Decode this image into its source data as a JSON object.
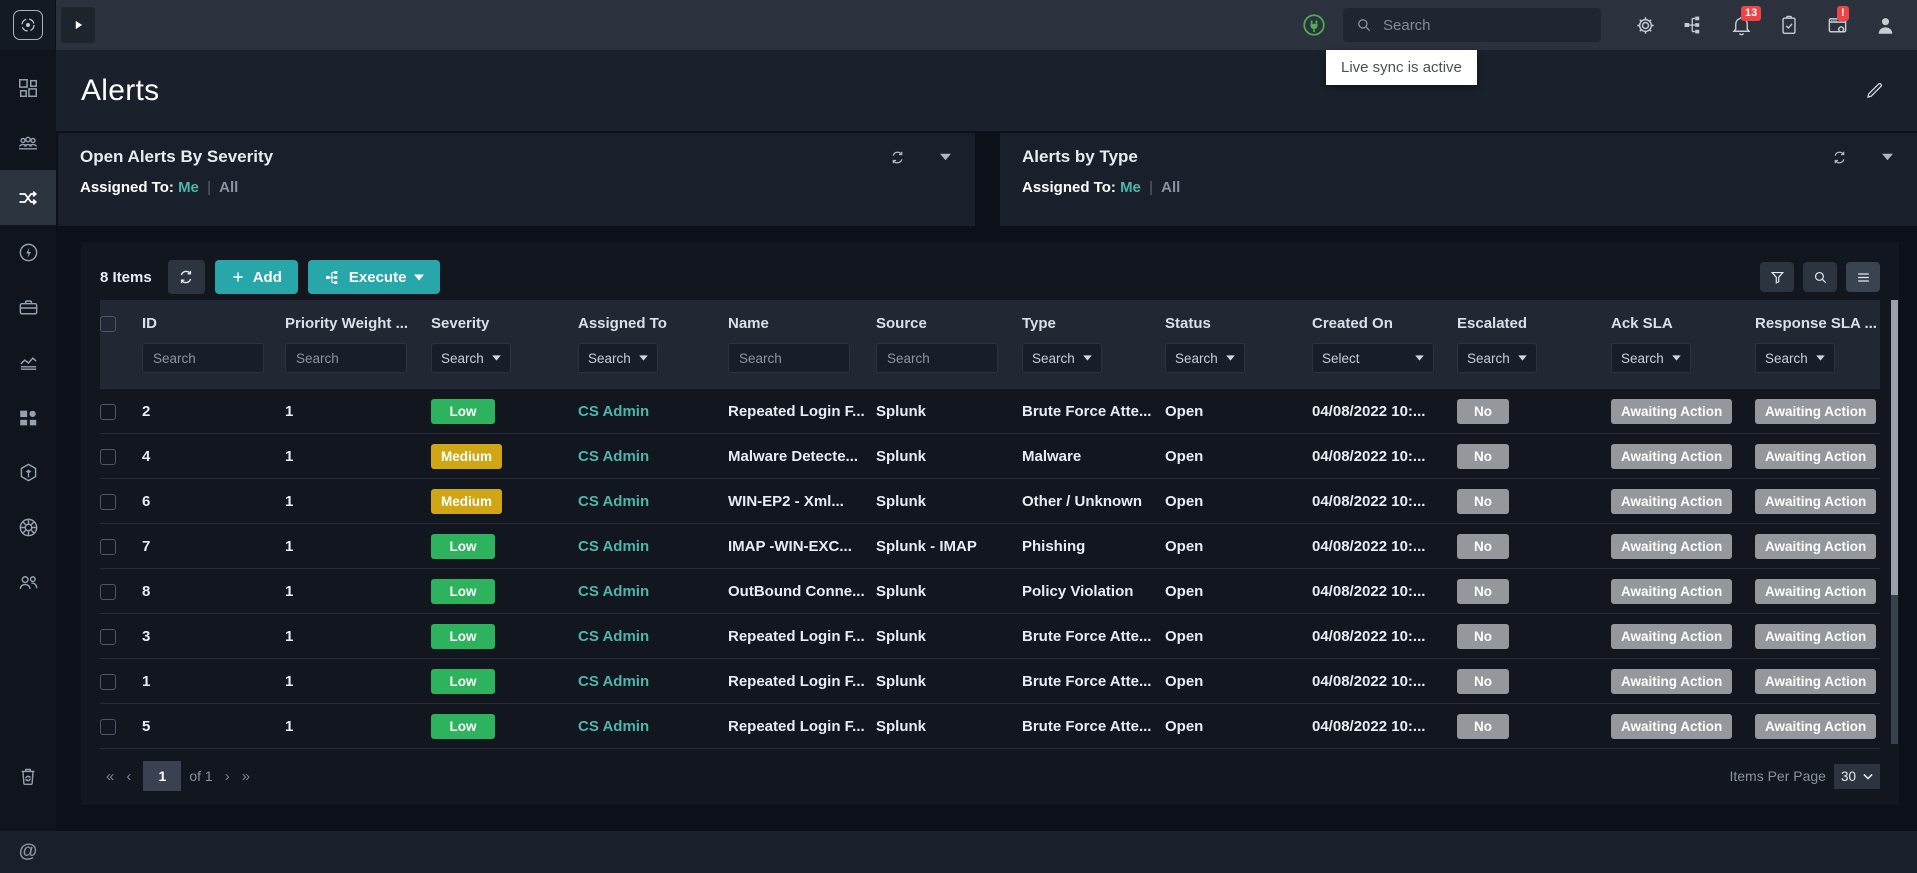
{
  "topbar": {
    "search_placeholder": "Search",
    "tooltip": "Live sync is active",
    "notifications_badge": "13",
    "apps_badge": "!"
  },
  "page": {
    "title": "Alerts"
  },
  "widgets": [
    {
      "title": "Open Alerts By Severity",
      "assigned_to_label": "Assigned To:",
      "me_label": "Me",
      "divider": "|",
      "all_label": "All"
    },
    {
      "title": "Alerts by Type",
      "assigned_to_label": "Assigned To:",
      "me_label": "Me",
      "divider": "|",
      "all_label": "All"
    }
  ],
  "toolbar": {
    "items_count": "8 Items",
    "add_label": "Add",
    "execute_label": "Execute"
  },
  "table": {
    "columns": [
      {
        "key": "id",
        "label": "ID",
        "filter": "input",
        "filter_placeholder": "Search"
      },
      {
        "key": "priority-weight",
        "label": "Priority Weight ...",
        "filter": "input",
        "filter_placeholder": "Search"
      },
      {
        "key": "severity",
        "label": "Severity",
        "filter": "select",
        "filter_placeholder": "Search"
      },
      {
        "key": "assigned-to",
        "label": "Assigned To",
        "filter": "select",
        "filter_placeholder": "Search"
      },
      {
        "key": "name",
        "label": "Name",
        "filter": "input",
        "filter_placeholder": "Search"
      },
      {
        "key": "source",
        "label": "Source",
        "filter": "input",
        "filter_placeholder": "Search"
      },
      {
        "key": "type",
        "label": "Type",
        "filter": "select",
        "filter_placeholder": "Search"
      },
      {
        "key": "status",
        "label": "Status",
        "filter": "select",
        "filter_placeholder": "Search"
      },
      {
        "key": "created-on",
        "label": "Created On",
        "filter": "select-wide",
        "filter_placeholder": "Select"
      },
      {
        "key": "escalated",
        "label": "Escalated",
        "filter": "select",
        "filter_placeholder": "Search"
      },
      {
        "key": "ack-sla",
        "label": "Ack SLA",
        "filter": "select",
        "filter_placeholder": "Search"
      },
      {
        "key": "response-sla",
        "label": "Response SLA ...",
        "filter": "select",
        "filter_placeholder": "Search"
      }
    ],
    "rows": [
      {
        "id": "2",
        "priority_weight": "1",
        "severity": "Low",
        "severity_level": "low",
        "assigned_to": "CS Admin",
        "name": "Repeated Login F...",
        "source": "Splunk",
        "type": "Brute Force Atte...",
        "status": "Open",
        "created_on": "04/08/2022 10:...",
        "escalated": "No",
        "ack_sla": "Awaiting Action",
        "response_sla": "Awaiting Action"
      },
      {
        "id": "4",
        "priority_weight": "1",
        "severity": "Medium",
        "severity_level": "medium",
        "assigned_to": "CS Admin",
        "name": "Malware Detecte...",
        "source": "Splunk",
        "type": "Malware",
        "status": "Open",
        "created_on": "04/08/2022 10:...",
        "escalated": "No",
        "ack_sla": "Awaiting Action",
        "response_sla": "Awaiting Action"
      },
      {
        "id": "6",
        "priority_weight": "1",
        "severity": "Medium",
        "severity_level": "medium",
        "assigned_to": "CS Admin",
        "name": "WIN-EP2 - Xml...",
        "source": "Splunk",
        "type": "Other / Unknown",
        "status": "Open",
        "created_on": "04/08/2022 10:...",
        "escalated": "No",
        "ack_sla": "Awaiting Action",
        "response_sla": "Awaiting Action"
      },
      {
        "id": "7",
        "priority_weight": "1",
        "severity": "Low",
        "severity_level": "low",
        "assigned_to": "CS Admin",
        "name": "IMAP -WIN-EXC...",
        "source": "Splunk - IMAP",
        "type": "Phishing",
        "status": "Open",
        "created_on": "04/08/2022 10:...",
        "escalated": "No",
        "ack_sla": "Awaiting Action",
        "response_sla": "Awaiting Action"
      },
      {
        "id": "8",
        "priority_weight": "1",
        "severity": "Low",
        "severity_level": "low",
        "assigned_to": "CS Admin",
        "name": "OutBound Conne...",
        "source": "Splunk",
        "type": "Policy Violation",
        "status": "Open",
        "created_on": "04/08/2022 10:...",
        "escalated": "No",
        "ack_sla": "Awaiting Action",
        "response_sla": "Awaiting Action"
      },
      {
        "id": "3",
        "priority_weight": "1",
        "severity": "Low",
        "severity_level": "low",
        "assigned_to": "CS Admin",
        "name": "Repeated Login F...",
        "source": "Splunk",
        "type": "Brute Force Atte...",
        "status": "Open",
        "created_on": "04/08/2022 10:...",
        "escalated": "No",
        "ack_sla": "Awaiting Action",
        "response_sla": "Awaiting Action"
      },
      {
        "id": "1",
        "priority_weight": "1",
        "severity": "Low",
        "severity_level": "low",
        "assigned_to": "CS Admin",
        "name": "Repeated Login F...",
        "source": "Splunk",
        "type": "Brute Force Atte...",
        "status": "Open",
        "created_on": "04/08/2022 10:...",
        "escalated": "No",
        "ack_sla": "Awaiting Action",
        "response_sla": "Awaiting Action"
      },
      {
        "id": "5",
        "priority_weight": "1",
        "severity": "Low",
        "severity_level": "low",
        "assigned_to": "CS Admin",
        "name": "Repeated Login F...",
        "source": "Splunk",
        "type": "Brute Force Atte...",
        "status": "Open",
        "created_on": "04/08/2022 10:...",
        "escalated": "No",
        "ack_sla": "Awaiting Action",
        "response_sla": "Awaiting Action"
      }
    ]
  },
  "pagination": {
    "current_page": "1",
    "of_label": "of 1",
    "items_per_page_label": "Items Per Page",
    "items_per_page_value": "30"
  },
  "colors": {
    "accent_teal": "#28a7aa",
    "link_teal": "#4db6ac",
    "severity_low": "#2db25d",
    "severity_medium": "#d0a614",
    "neutral_badge": "#94979c",
    "live_sync_green": "#4caf50",
    "badge_red": "#ef4444"
  }
}
